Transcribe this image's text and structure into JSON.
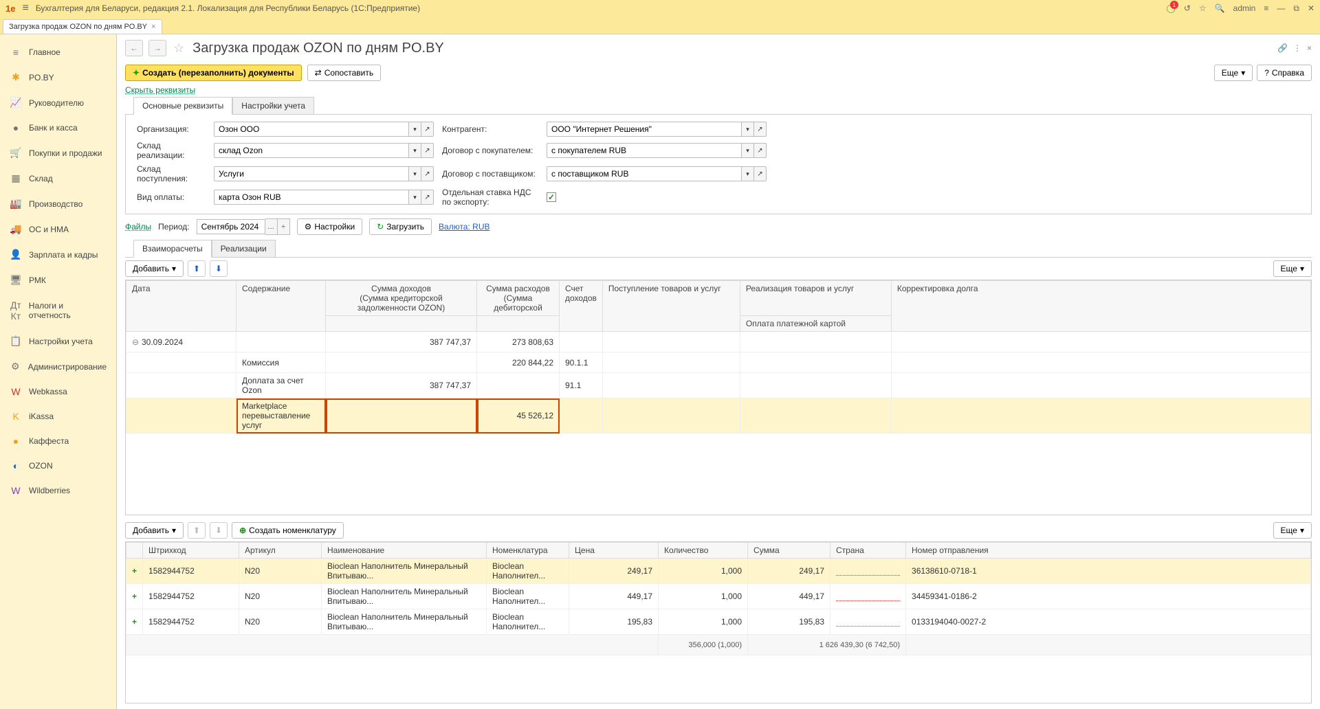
{
  "app": {
    "logo": "1e",
    "title": "Бухгалтерия для Беларуси, редакция 2.1. Локализация для Республики Беларусь  (1С:Предприятие)",
    "user": "admin",
    "bell_badge": "1"
  },
  "tabs": [
    {
      "label": "Загрузка продаж OZON по дням PO.BY"
    }
  ],
  "sidebar": [
    {
      "icon": "≡",
      "label": "Главное",
      "cls": "sb-icon-gray"
    },
    {
      "icon": "✱",
      "label": "PO.BY",
      "cls": "sb-icon-orange"
    },
    {
      "icon": "📈",
      "label": "Руководителю",
      "cls": "sb-icon-gray"
    },
    {
      "icon": "●",
      "label": "Банк и касса",
      "cls": "sb-icon-gray"
    },
    {
      "icon": "🛒",
      "label": "Покупки и продажи",
      "cls": "sb-icon-orange"
    },
    {
      "icon": "▦",
      "label": "Склад",
      "cls": "sb-icon-gray"
    },
    {
      "icon": "🏭",
      "label": "Производство",
      "cls": "sb-icon-gray"
    },
    {
      "icon": "🚚",
      "label": "ОС и НМА",
      "cls": "sb-icon-gray"
    },
    {
      "icon": "👤",
      "label": "Зарплата и кадры",
      "cls": "sb-icon-gray"
    },
    {
      "icon": "🖥",
      "label": "РМК",
      "cls": "sb-icon-gray"
    },
    {
      "icon": "Дт Кт",
      "label": "Налоги и отчетность",
      "cls": "sb-icon-gray"
    },
    {
      "icon": "📋",
      "label": "Настройки учета",
      "cls": "sb-icon-gray"
    },
    {
      "icon": "⚙",
      "label": "Администрирование",
      "cls": "sb-icon-gray"
    },
    {
      "icon": "W",
      "label": "Webkassa",
      "cls": "sb-icon-red"
    },
    {
      "icon": "K",
      "label": "iKassa",
      "cls": "sb-icon-orange"
    },
    {
      "icon": "●",
      "label": "Каффеста",
      "cls": "sb-icon-orange"
    },
    {
      "icon": "◐",
      "label": "OZON",
      "cls": "sb-icon-blue"
    },
    {
      "icon": "W",
      "label": "Wildberries",
      "cls": "sb-icon-purple"
    }
  ],
  "page": {
    "title": "Загрузка продаж OZON по дням PO.BY",
    "btn_create": "Создать (перезаполнить) документы",
    "btn_compare": "Сопоставить",
    "btn_more": "Еще",
    "btn_help": "Справка",
    "link_hide": "Скрыть реквизиты"
  },
  "inner_tabs_top": [
    {
      "label": "Основные реквизиты",
      "active": true
    },
    {
      "label": "Настройки учета",
      "active": false
    }
  ],
  "form": {
    "org_label": "Организация:",
    "org_value": "Озон ООО",
    "contr_label": "Контрагент:",
    "contr_value": "ООО \"Интернет Решения\"",
    "sklad_real_label": "Склад реализации:",
    "sklad_real_value": "склад Ozon",
    "dog_pok_label": "Договор с покупателем:",
    "dog_pok_value": "с покупателем RUB",
    "sklad_post_label": "Склад поступления:",
    "sklad_post_value": "Услуги",
    "dog_post_label": "Договор с поставщиком:",
    "dog_post_value": "с поставщиком RUB",
    "vid_oplaty_label": "Вид оплаты:",
    "vid_oplaty_value": "карта Озон RUB",
    "nds_label": "Отдельная ставка НДС по экспорту:"
  },
  "toolbar2": {
    "files_link": "Файлы",
    "period_label": "Период:",
    "period_value": "Сентябрь 2024 г.",
    "btn_settings": "Настройки",
    "btn_load": "Загрузить",
    "currency_link": "Валюта: RUB"
  },
  "inner_tabs_mid": [
    {
      "label": "Взаиморасчеты",
      "active": true
    },
    {
      "label": "Реализации",
      "active": false
    }
  ],
  "upper_toolbar": {
    "btn_add": "Добавить",
    "btn_more": "Еще"
  },
  "upper_table": {
    "headers": {
      "date": "Дата",
      "content": "Содержание",
      "income": "Сумма доходов",
      "income2": "(Сумма кредиторской задолженности OZON)",
      "expense": "Сумма расходов",
      "expense2": "(Сумма дебиторской",
      "account": "Счет доходов",
      "receipt": "Поступление товаров и услуг",
      "realiz": "Реализация товаров и услуг",
      "pay": "Оплата платежной картой",
      "korr": "Корректировка долга"
    },
    "rows": [
      {
        "date": "30.09.2024",
        "content": "",
        "income": "387 747,37",
        "expense": "273 808,63",
        "account": "",
        "tree": true
      },
      {
        "date": "",
        "content": "Комиссия",
        "income": "",
        "expense": "220 844,22",
        "account": "90.1.1"
      },
      {
        "date": "",
        "content": "Доплата за счет Ozon",
        "income": "387 747,37",
        "expense": "",
        "account": "91.1"
      },
      {
        "date": "",
        "content": "Marketplace перевыставление услуг",
        "income": "",
        "expense": "45 526,12",
        "account": "",
        "highlighted": true
      }
    ]
  },
  "lower_toolbar": {
    "btn_add": "Добавить",
    "btn_create_nom": "Создать номенклатуру",
    "btn_more": "Еще"
  },
  "lower_table": {
    "headers": {
      "barcode": "Штрихкод",
      "article": "Артикул",
      "name": "Наименование",
      "nomen": "Номенклатура",
      "price": "Цена",
      "qty": "Количество",
      "sum": "Сумма",
      "country": "Страна",
      "shipment": "Номер отправления"
    },
    "rows": [
      {
        "barcode": "1582944752",
        "article": "N20",
        "name": "Bioclean Наполнитель Минеральный Впитываю...",
        "nomen": "Bioclean Наполнител...",
        "price": "249,17",
        "qty": "1,000",
        "sum": "249,17",
        "shipment": "36138610-0718-1",
        "hl": true
      },
      {
        "barcode": "1582944752",
        "article": "N20",
        "name": "Bioclean Наполнитель Минеральный Впитываю...",
        "nomen": "Bioclean Наполнител...",
        "price": "449,17",
        "qty": "1,000",
        "sum": "449,17",
        "shipment": "34459341-0186-2"
      },
      {
        "barcode": "1582944752",
        "article": "N20",
        "name": "Bioclean Наполнитель Минеральный Впитываю...",
        "nomen": "Bioclean Наполнител...",
        "price": "195,83",
        "qty": "1,000",
        "sum": "195,83",
        "shipment": "0133194040-0027-2"
      }
    ],
    "footer": {
      "qty": "356,000 (1,000)",
      "sum": "1 626 439,30 (6 742,50)"
    }
  }
}
